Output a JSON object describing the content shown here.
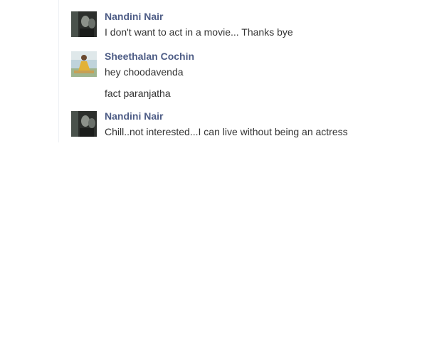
{
  "messages": [
    {
      "sender": "Nandini Nair",
      "avatar_icon": "profile-photo-dark-icon",
      "lines": [
        "I don't want to act in a movie... Thanks bye"
      ]
    },
    {
      "sender": "Sheethalan Cochin",
      "avatar_icon": "profile-photo-outdoor-icon",
      "lines": [
        "hey choodavenda",
        "fact paranjatha"
      ]
    },
    {
      "sender": "Nandini Nair",
      "avatar_icon": "profile-photo-dark-icon",
      "lines": [
        "Chill..not interested...I can live without being an actress"
      ]
    }
  ],
  "colors": {
    "name": "#4e5d86",
    "text": "#333333",
    "divider": "#eef0f4"
  }
}
